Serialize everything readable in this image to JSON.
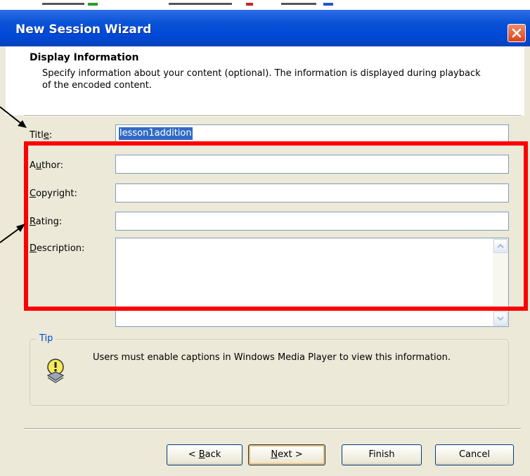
{
  "window": {
    "title": "New Session Wizard"
  },
  "header": {
    "title": "Display Information",
    "description": "Specify information about your content (optional). The information is displayed during playback of the encoded content."
  },
  "form": {
    "title_label_pre": "Titl",
    "title_label_key": "e",
    "title_label_post": ":",
    "title_value": "lesson1addition",
    "author_label_pre": "A",
    "author_label_key": "u",
    "author_label_post": "thor:",
    "author_value": "",
    "copyright_label_key": "C",
    "copyright_label_post": "opyright:",
    "copyright_value": "",
    "rating_label_key": "R",
    "rating_label_post": "ating:",
    "rating_value": "",
    "description_label_key": "D",
    "description_label_post": "escription:",
    "description_value": ""
  },
  "tip": {
    "legend": "Tip",
    "text": "Users must enable captions in Windows Media Player to view this information.",
    "icon": "lightbulb-icon"
  },
  "buttons": {
    "back_pre": "< ",
    "back_key": "B",
    "back_post": "ack",
    "next_key": "N",
    "next_post": "ext >",
    "finish": "Finish",
    "cancel": "Cancel"
  },
  "colors": {
    "titlebar": "#0a53d6",
    "dialog_bg": "#ece9d8",
    "selection": "#316ac5",
    "annotation": "#ff0000",
    "tip_legend": "#0046d5"
  }
}
